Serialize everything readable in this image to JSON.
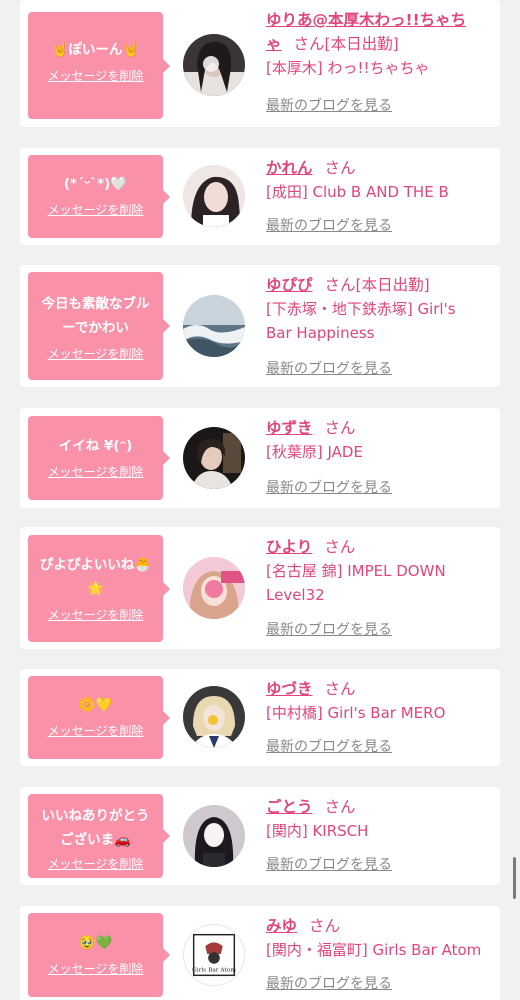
{
  "cards": [
    {
      "message": "🤘ぽいーん🤘",
      "delete_label": "メッセージを削除",
      "name": "ゆりあ@本厚木わっ!!ちゃちゃ",
      "name_line1": "ゆりあ@本厚木わっ!!ちゃち",
      "name_line2": "ゃ",
      "suffix": "さん",
      "status": "[本日出勤]",
      "shop": "[本厚木] わっ!!ちゃちゃ",
      "blog_label": "最新のブログを見る"
    },
    {
      "message": "(*ˊᵕˋ*)🤍",
      "delete_label": "メッセージを削除",
      "name": "かれん",
      "suffix": "さん",
      "status": "",
      "shop": "[成田] Club B AND THE B",
      "blog_label": "最新のブログを見る"
    },
    {
      "message_line1": "今日も素敵なブル",
      "message_line2": "ーでかわい",
      "delete_label": "メッセージを削除",
      "name": "ゆぴぴ",
      "suffix": "さん",
      "status": "[本日出勤]",
      "shop_line1": "[下赤塚・地下鉄赤塚] Girl's",
      "shop_line2": "Bar Happiness",
      "blog_label": "最新のブログを見る"
    },
    {
      "message": "イイね ¥(ᵔ)",
      "delete_label": "メッセージを削除",
      "name": "ゆずき",
      "suffix": "さん",
      "status": "",
      "shop": "[秋葉原] JADE",
      "blog_label": "最新のブログを見る"
    },
    {
      "message_line1": "ぴよぴよいいね🐣",
      "message_line2": "🌟",
      "delete_label": "メッセージを削除",
      "name": "ひより",
      "suffix": "さん",
      "status": "",
      "shop_line1": "[名古屋 錦] IMPEL DOWN",
      "shop_line2": "Level32",
      "blog_label": "最新のブログを見る"
    },
    {
      "message": "🌼💛",
      "delete_label": "メッセージを削除",
      "name": "ゆづき",
      "suffix": "さん",
      "status": "",
      "shop": "[中村橋] Girl's Bar MERO",
      "blog_label": "最新のブログを見る"
    },
    {
      "message_line1": "いいねありがとう",
      "message_line2": "ございま🚗",
      "delete_label": "メッセージを削除",
      "name": "ごとう",
      "suffix": "さん",
      "status": "",
      "shop": "[関内] KIRSCH",
      "blog_label": "最新のブログを見る"
    },
    {
      "message": "🥹💚",
      "delete_label": "メッセージを削除",
      "name": "みゆ",
      "suffix": "さん",
      "status": "",
      "shop": "[関内・福富町] Girls Bar Atom",
      "blog_label": "最新のブログを見る",
      "avatar_logo_text": "Girls Bar Atom"
    }
  ],
  "colors": {
    "bubble": "#f992a8",
    "accent": "#e1457a",
    "muted": "#888888",
    "background": "#f1f1f1"
  }
}
